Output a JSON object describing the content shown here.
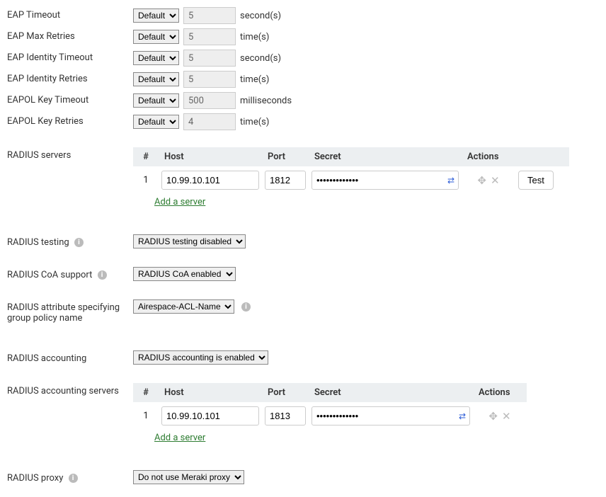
{
  "eap": [
    {
      "label": "EAP Timeout",
      "mode": "Default",
      "value": "5",
      "unit": "second(s)"
    },
    {
      "label": "EAP Max Retries",
      "mode": "Default",
      "value": "5",
      "unit": "time(s)"
    },
    {
      "label": "EAP Identity Timeout",
      "mode": "Default",
      "value": "5",
      "unit": "second(s)"
    },
    {
      "label": "EAP Identity Retries",
      "mode": "Default",
      "value": "5",
      "unit": "time(s)"
    },
    {
      "label": "EAPOL Key Timeout",
      "mode": "Default",
      "value": "500",
      "unit": "milliseconds"
    },
    {
      "label": "EAPOL Key Retries",
      "mode": "Default",
      "value": "4",
      "unit": "time(s)"
    }
  ],
  "radius_servers": {
    "label": "RADIUS servers",
    "headers": {
      "num": "#",
      "host": "Host",
      "port": "Port",
      "secret": "Secret",
      "actions": "Actions",
      "test": ""
    },
    "rows": [
      {
        "num": "1",
        "host": "10.99.10.101",
        "port": "1812",
        "secret": "•••••••••••••"
      }
    ],
    "add_link": "Add a server",
    "test_label": "Test"
  },
  "radius_testing": {
    "label": "RADIUS testing",
    "value": "RADIUS testing disabled"
  },
  "radius_coa": {
    "label": "RADIUS CoA support",
    "value": "RADIUS CoA enabled"
  },
  "radius_attr": {
    "label": "RADIUS attribute specifying group policy name",
    "value": "Airespace-ACL-Name"
  },
  "radius_accounting": {
    "label": "RADIUS accounting",
    "value": "RADIUS accounting is enabled"
  },
  "radius_accounting_servers": {
    "label": "RADIUS accounting servers",
    "headers": {
      "num": "#",
      "host": "Host",
      "port": "Port",
      "secret": "Secret",
      "actions": "Actions"
    },
    "rows": [
      {
        "num": "1",
        "host": "10.99.10.101",
        "port": "1813",
        "secret": "•••••••••••••"
      }
    ],
    "add_link": "Add a server"
  },
  "radius_proxy": {
    "label": "RADIUS proxy",
    "value": "Do not use Meraki proxy"
  }
}
